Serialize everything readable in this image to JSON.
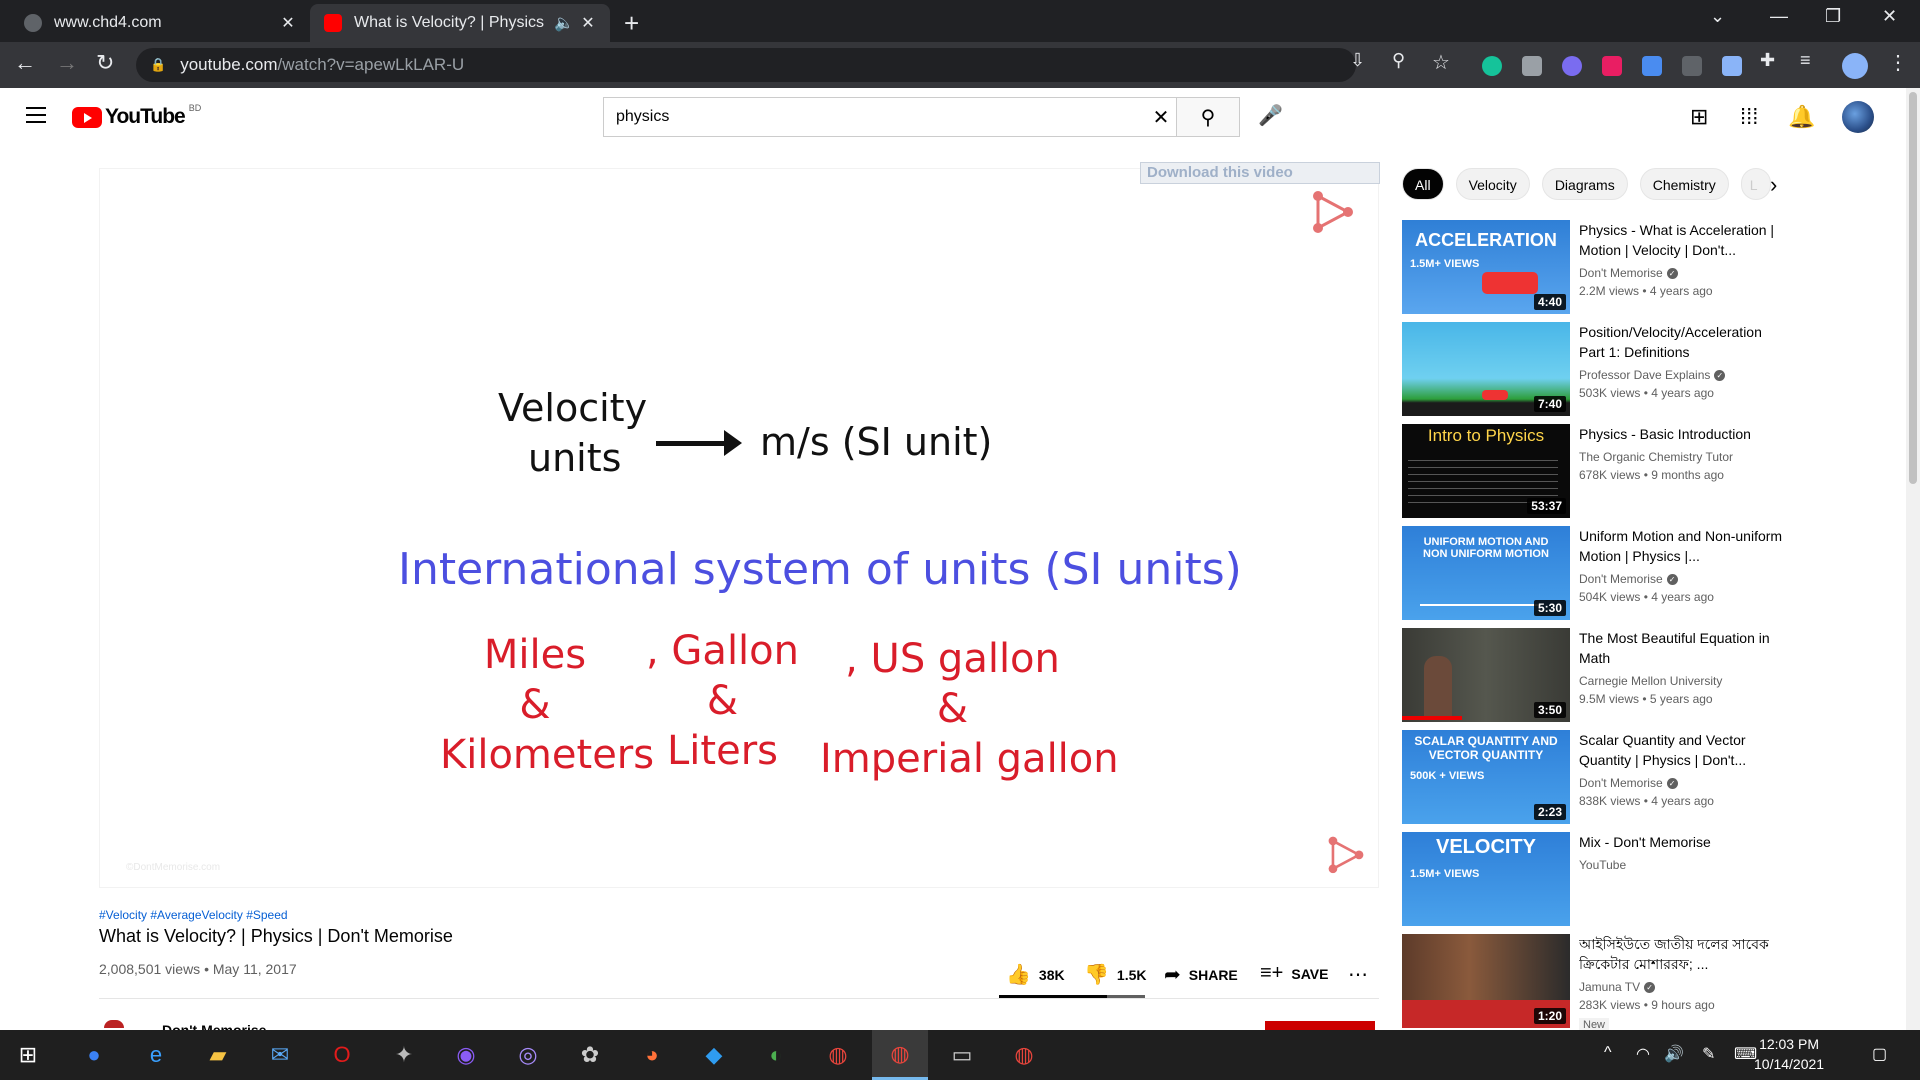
{
  "browser": {
    "tabs": [
      {
        "title": "www.chd4.com",
        "active": false
      },
      {
        "title": "What is Velocity? | Physics | Don't Memorise",
        "active": true
      }
    ],
    "url_host": "youtube.com",
    "url_path": "/watch?v=apewLkLAR-U"
  },
  "youtube": {
    "logo_text": "YouTube",
    "country_code": "BD",
    "search_query": "physics"
  },
  "player": {
    "download_label": "Download this video",
    "slide": {
      "line1a": "Velocity",
      "line1b": "units",
      "line1c": "m/s  (SI unit)",
      "line2": "International system of units  (SI units)",
      "col1": [
        "Miles",
        "&",
        "Kilometers"
      ],
      "col2": [
        ", Gallon",
        "&",
        "Liters"
      ],
      "col3": [
        ", US gallon",
        "&",
        "Imperial gallon"
      ],
      "watermark": "©DontMemorise.com"
    },
    "colors": {
      "blue_text": "#4c4fe0",
      "red_text": "#d91d2a"
    }
  },
  "video": {
    "hashtags": "#Velocity #AverageVelocity #Speed",
    "title": "What is Velocity? | Physics | Don't Memorise",
    "meta": "2,008,501 views • May 11, 2017",
    "likes": "38K",
    "dislikes": "1.5K",
    "share_label": "SHARE",
    "save_label": "SAVE",
    "channel": "Don't Memorise"
  },
  "sidebar": {
    "chips": [
      "All",
      "Velocity",
      "Diagrams",
      "Chemistry",
      "L"
    ],
    "recs": [
      {
        "title": "Physics - What is Acceleration | Motion | Velocity | Don't...",
        "channel": "Don't Memorise",
        "verified": true,
        "meta": "2.2M views • 4 years ago",
        "duration": "4:40",
        "thumb_text": "ACCELERATION",
        "badge": "1.5M+ VIEWS"
      },
      {
        "title": "Position/Velocity/Acceleration Part 1: Definitions",
        "channel": "Professor Dave Explains",
        "verified": true,
        "meta": "503K views • 4 years ago",
        "duration": "7:40",
        "thumb_text": "",
        "badge": ""
      },
      {
        "title": "Physics - Basic Introduction",
        "channel": "The Organic Chemistry Tutor",
        "verified": false,
        "meta": "678K views • 9 months ago",
        "duration": "53:37",
        "thumb_text": "Intro to Physics",
        "badge": ""
      },
      {
        "title": "Uniform Motion and Non-uniform Motion | Physics |...",
        "channel": "Don't Memorise",
        "verified": true,
        "meta": "504K views • 4 years ago",
        "duration": "5:30",
        "thumb_text": "UNIFORM MOTION AND NON UNIFORM MOTION",
        "badge": ""
      },
      {
        "title": "The Most Beautiful Equation in Math",
        "channel": "Carnegie Mellon University",
        "verified": false,
        "meta": "9.5M views • 5 years ago",
        "duration": "3:50",
        "thumb_text": "",
        "badge": ""
      },
      {
        "title": "Scalar Quantity and Vector Quantity | Physics | Don't...",
        "channel": "Don't Memorise",
        "verified": true,
        "meta": "838K views • 4 years ago",
        "duration": "2:23",
        "thumb_text": "SCALAR QUANTITY AND VECTOR QUANTITY",
        "badge": "500K + VIEWS"
      },
      {
        "title": "Mix - Don't Memorise",
        "channel": "YouTube",
        "verified": false,
        "meta": "",
        "duration": "",
        "thumb_text": "VELOCITY",
        "badge": "1.5M+ VIEWS"
      },
      {
        "title": "আইসিইউতে জাতীয় দলের সাবেক ক্রিকেটার মোশাররফ; ...",
        "channel": "Jamuna TV",
        "verified": true,
        "meta": "283K views • 9 hours ago",
        "duration": "1:20",
        "thumb_text": "",
        "badge": "",
        "new_label": "New"
      }
    ]
  },
  "taskbar": {
    "time": "12:03 PM",
    "date": "10/14/2021"
  }
}
